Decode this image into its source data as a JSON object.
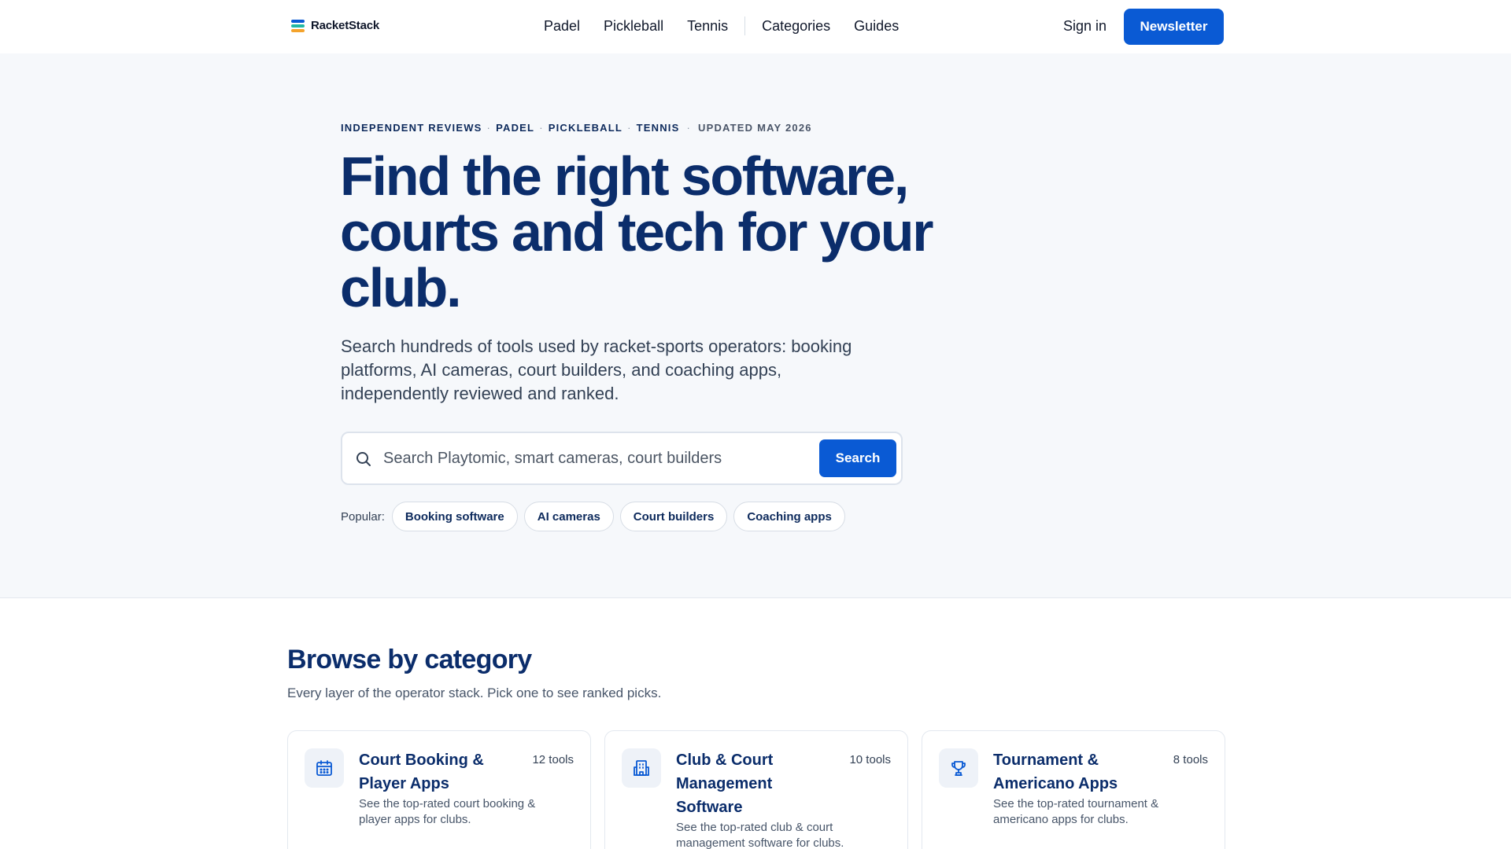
{
  "brand": {
    "name": "RacketStack",
    "logo_colors": [
      "#0a5ad4",
      "#22b8a5",
      "#f4a32c"
    ]
  },
  "nav": {
    "items": [
      "Padel",
      "Pickleball",
      "Tennis",
      "Categories",
      "Guides"
    ],
    "sign_in": "Sign in",
    "newsletter": "Newsletter"
  },
  "hero": {
    "eyebrow_parts": [
      "INDEPENDENT REVIEWS",
      "PADEL",
      "PICKLEBALL",
      "TENNIS"
    ],
    "updated": "UPDATED MAY 2026",
    "headline": "Find the right software, courts and tech for your club.",
    "subhead": "Search hundreds of tools used by racket-sports operators: booking platforms, AI cameras, court builders, and coaching apps, independently reviewed and ranked.",
    "search": {
      "placeholder": "Search Playtomic, smart cameras, court builders...",
      "button": "Search"
    },
    "popular_label": "Popular:",
    "popular_chips": [
      "Booking software",
      "AI cameras",
      "Court builders",
      "Coaching apps"
    ]
  },
  "categories": {
    "title": "Browse by category",
    "subtitle": "Every layer of the operator stack. Pick one to see ranked picks.",
    "cards": [
      {
        "icon": "calendar-icon",
        "title": "Court Booking & Player Apps",
        "count": "12 tools",
        "desc": "See the top-rated court booking & player apps for clubs."
      },
      {
        "icon": "building-icon",
        "title": "Club & Court Management Software",
        "count": "10 tools",
        "desc": "See the top-rated club & court management software for clubs."
      },
      {
        "icon": "trophy-icon",
        "title": "Tournament & Americano Apps",
        "count": "8 tools",
        "desc": "See the top-rated tournament & americano apps for clubs."
      }
    ]
  },
  "colors": {
    "accent": "#0a5ad4",
    "heading": "#0b2d6b",
    "hero_bg": "#f6f8fb"
  }
}
